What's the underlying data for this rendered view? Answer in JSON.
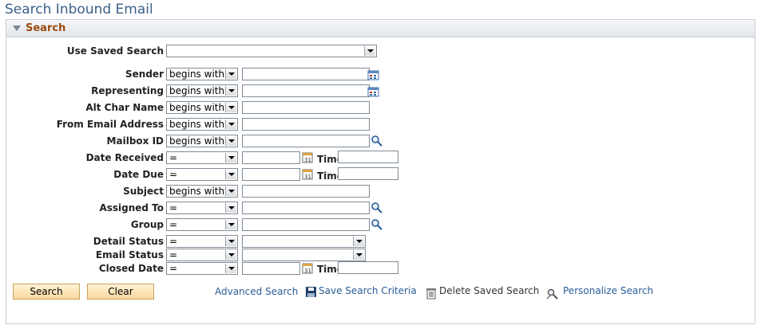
{
  "page": {
    "title": "Search Inbound Email"
  },
  "panel": {
    "label": "Search"
  },
  "saved_search": {
    "label": "Use Saved Search",
    "value": ""
  },
  "fields": {
    "sender": {
      "label": "Sender",
      "operator": "begins with"
    },
    "representing": {
      "label": "Representing",
      "operator": "begins with"
    },
    "alt_char_name": {
      "label": "Alt Char Name",
      "operator": "begins with"
    },
    "from_email": {
      "label": "From Email Address",
      "operator": "begins with"
    },
    "mailbox_id": {
      "label": "Mailbox ID",
      "operator": "begins with"
    },
    "date_received": {
      "label": "Date Received",
      "operator": "=",
      "time_label": "Time"
    },
    "date_due": {
      "label": "Date Due",
      "operator": "=",
      "time_label": "Time"
    },
    "subject": {
      "label": "Subject",
      "operator": "begins with"
    },
    "assigned_to": {
      "label": "Assigned To",
      "operator": "="
    },
    "group": {
      "label": "Group",
      "operator": "="
    },
    "detail_status": {
      "label": "Detail Status",
      "operator": "="
    },
    "email_status": {
      "label": "Email Status",
      "operator": "="
    },
    "closed_date": {
      "label": "Closed Date",
      "operator": "=",
      "time_label": "Time"
    }
  },
  "actions": {
    "search": "Search",
    "clear": "Clear",
    "advanced_search": "Advanced Search",
    "save_criteria": "Save Search Criteria",
    "delete_saved": "Delete Saved Search",
    "personalize": "Personalize Search"
  },
  "colors": {
    "title": "#3a5f8a",
    "panel_label": "#9b4a0c",
    "link": "#2a5d98",
    "button": "#f8d89e"
  },
  "icons": [
    "collapse-triangle-icon",
    "lookup-person-icon",
    "magnifier-icon",
    "calendar-icon",
    "save-icon",
    "trash-icon",
    "personalize-icon"
  ]
}
